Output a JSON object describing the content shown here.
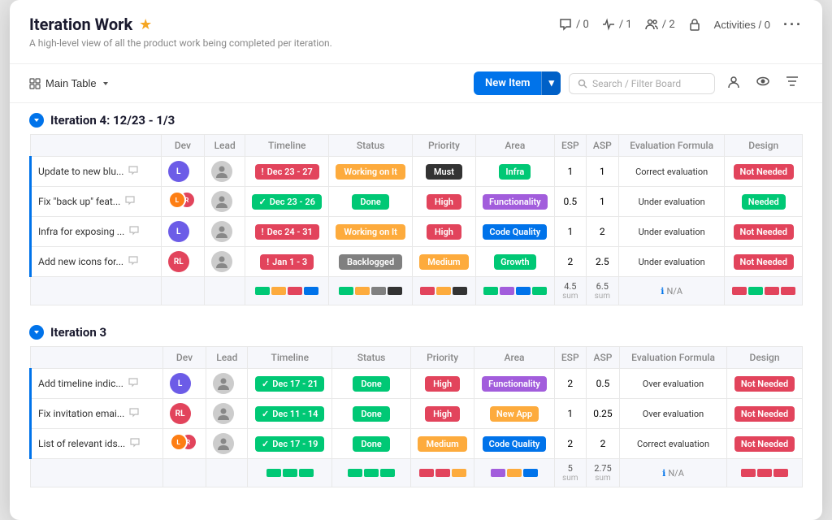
{
  "header": {
    "title": "Iteration Work",
    "subtitle": "A high-level view of all the product work being completed per iteration.",
    "stats": [
      {
        "icon": "comment",
        "value": "/ 0"
      },
      {
        "icon": "pulse",
        "value": "/ 1"
      },
      {
        "icon": "team",
        "value": "/ 2"
      },
      {
        "icon": "lock",
        "value": ""
      }
    ],
    "activities_label": "Activities / 0",
    "more_label": "..."
  },
  "toolbar": {
    "main_table_label": "Main Table",
    "new_item_label": "New Item",
    "search_placeholder": "Search / Filter Board"
  },
  "iteration4": {
    "title": "Iteration 4: 12/23 - 1/3",
    "columns": [
      "",
      "Dev",
      "Lead",
      "Timeline",
      "Status",
      "Priority",
      "Area",
      "ESP",
      "ASP",
      "Evaluation Formula",
      "Design"
    ],
    "rows": [
      {
        "name": "Update to new blu...",
        "dev_initials": "L",
        "dev_color": "#6c5ce7",
        "timeline": "Dec 23 - 27",
        "timeline_color": "#e2445c",
        "timeline_icon": "!",
        "status": "Working on It",
        "status_color": "#fdab3d",
        "priority": "Must",
        "priority_color": "#333333",
        "area": "Infra",
        "area_color": "#00c875",
        "esp": "1",
        "asp": "1",
        "eval": "Correct evaluation",
        "design": "Not Needed",
        "design_color": "#e2445c"
      },
      {
        "name": "Fix \"back up\" feat...",
        "dev_initials": "multi",
        "dev_color": "#fd7e14",
        "timeline": "Dec 23 - 26",
        "timeline_color": "#00c875",
        "timeline_icon": "✓",
        "status": "Done",
        "status_color": "#00c875",
        "priority": "High",
        "priority_color": "#e2445c",
        "area": "Functionality",
        "area_color": "#a25ddc",
        "esp": "0.5",
        "asp": "1",
        "eval": "Under evaluation",
        "design": "Needed",
        "design_color": "#00c875"
      },
      {
        "name": "Infra for exposing ...",
        "dev_initials": "L",
        "dev_color": "#6c5ce7",
        "timeline": "Dec 24 - 31",
        "timeline_color": "#e2445c",
        "timeline_icon": "!",
        "status": "Working on It",
        "status_color": "#fdab3d",
        "priority": "High",
        "priority_color": "#e2445c",
        "area": "Code Quality",
        "area_color": "#0073ea",
        "esp": "1",
        "asp": "2",
        "eval": "Under evaluation",
        "design": "Not Needed",
        "design_color": "#e2445c"
      },
      {
        "name": "Add new icons for...",
        "dev_initials": "RL",
        "dev_color": "#e2445c",
        "timeline": "Jan 1 - 3",
        "timeline_color": "#e2445c",
        "timeline_icon": "!",
        "status": "Backlogged",
        "status_color": "#808080",
        "priority": "Medium",
        "priority_color": "#fdab3d",
        "area": "Growth",
        "area_color": "#00c875",
        "esp": "2",
        "asp": "2.5",
        "eval": "Under evaluation",
        "design": "Not Needed",
        "design_color": "#e2445c"
      }
    ],
    "summary": {
      "esp_sum": "4.5",
      "asp_sum": "6.5",
      "eval_na": "N/A",
      "timeline_colors": [
        "#00c875",
        "#fdab3d",
        "#e2445c",
        "#0073ea"
      ],
      "status_colors": [
        "#00c875",
        "#fdab3d",
        "#808080",
        "#333"
      ],
      "priority_colors": [
        "#e2445c",
        "#fdab3d",
        "#333"
      ],
      "area_colors": [
        "#00c875",
        "#a25ddc",
        "#0073ea",
        "#00c875"
      ],
      "design_colors": [
        "#e2445c",
        "#00c875",
        "#e2445c",
        "#e2445c"
      ]
    }
  },
  "iteration3": {
    "title": "Iteration 3",
    "columns": [
      "",
      "Dev",
      "Lead",
      "Timeline",
      "Status",
      "Priority",
      "Area",
      "ESP",
      "ASP",
      "Evaluation Formula",
      "Design"
    ],
    "rows": [
      {
        "name": "Add timeline indic...",
        "dev_initials": "L",
        "dev_color": "#6c5ce7",
        "timeline": "Dec 17 - 21",
        "timeline_color": "#00c875",
        "timeline_icon": "✓",
        "status": "Done",
        "status_color": "#00c875",
        "priority": "High",
        "priority_color": "#e2445c",
        "area": "Functionality",
        "area_color": "#a25ddc",
        "esp": "2",
        "asp": "0.5",
        "eval": "Over evaluation",
        "design": "Not Needed",
        "design_color": "#e2445c"
      },
      {
        "name": "Fix invitation emai...",
        "dev_initials": "RL",
        "dev_color": "#e2445c",
        "timeline": "Dec 11 - 14",
        "timeline_color": "#00c875",
        "timeline_icon": "✓",
        "status": "Done",
        "status_color": "#00c875",
        "priority": "High",
        "priority_color": "#e2445c",
        "area": "New App",
        "area_color": "#fdab3d",
        "esp": "1",
        "asp": "0.25",
        "eval": "Over evaluation",
        "design": "Not Needed",
        "design_color": "#e2445c"
      },
      {
        "name": "List of relevant ids...",
        "dev_initials": "multi",
        "dev_color": "#fd7e14",
        "timeline": "Dec 17 - 19",
        "timeline_color": "#00c875",
        "timeline_icon": "✓",
        "status": "Done",
        "status_color": "#00c875",
        "priority": "Medium",
        "priority_color": "#fdab3d",
        "area": "Code Quality",
        "area_color": "#0073ea",
        "esp": "2",
        "asp": "2",
        "eval": "Correct evaluation",
        "design": "Not Needed",
        "design_color": "#e2445c"
      }
    ],
    "summary": {
      "esp_sum": "5",
      "asp_sum": "2.75",
      "eval_na": "N/A",
      "timeline_colors": [
        "#00c875",
        "#00c875",
        "#00c875"
      ],
      "status_colors": [
        "#00c875",
        "#00c875",
        "#00c875"
      ],
      "priority_colors": [
        "#e2445c",
        "#e2445c",
        "#fdab3d"
      ],
      "area_colors": [
        "#a25ddc",
        "#fdab3d",
        "#0073ea"
      ],
      "design_colors": [
        "#e2445c",
        "#e2445c",
        "#e2445c"
      ]
    }
  }
}
